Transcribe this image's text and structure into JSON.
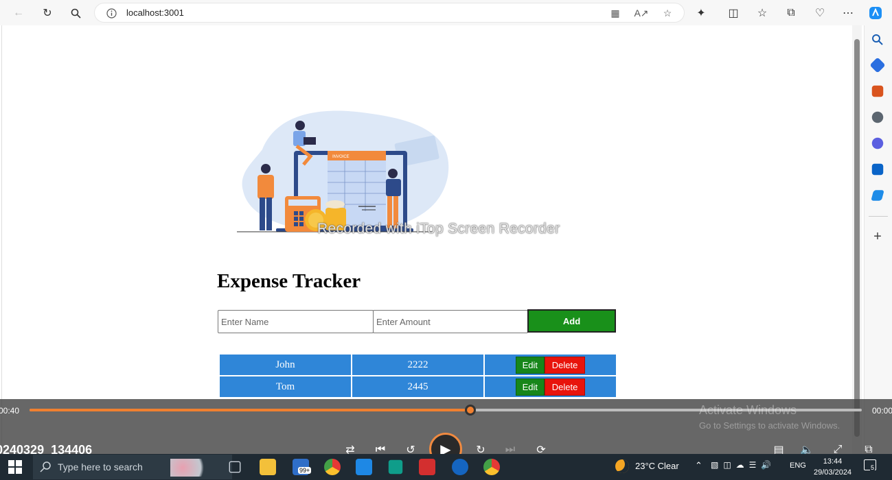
{
  "browser": {
    "url": "localhost:3001",
    "back_icon": "arrow-left-icon",
    "refresh_icon": "refresh-icon",
    "search_icon": "search-icon"
  },
  "app": {
    "title": "Expense Tracker",
    "name_placeholder": "Enter Name",
    "amount_placeholder": "Enter Amount",
    "add_label": "Add",
    "rows": [
      {
        "name": "John",
        "amount": "2222",
        "edit": "Edit",
        "delete": "Delete"
      },
      {
        "name": "Tom",
        "amount": "2445",
        "edit": "Edit",
        "delete": "Delete"
      }
    ],
    "illustration_text": "INVOICE"
  },
  "recorder": {
    "watermark": "Recorded with iTop Screen Recorder",
    "time_elapsed": "00:40",
    "time_total": "00:00",
    "progress": 0.53,
    "file_name": "0240329_134406",
    "activate_title": "Activate Windows",
    "activate_sub": "Go to Settings to activate Windows."
  },
  "taskbar": {
    "search_placeholder": "Type here to search",
    "mail_badge": "99+",
    "weather": "23°C  Clear",
    "language": "ENG",
    "time": "13:44",
    "date": "29/03/2024",
    "notification_count": "5"
  },
  "colors": {
    "add_button": "#19901a",
    "table_cell": "#2f86d8",
    "edit_button": "#17861a",
    "delete_button": "#e8140c",
    "progress": "#f08030"
  }
}
